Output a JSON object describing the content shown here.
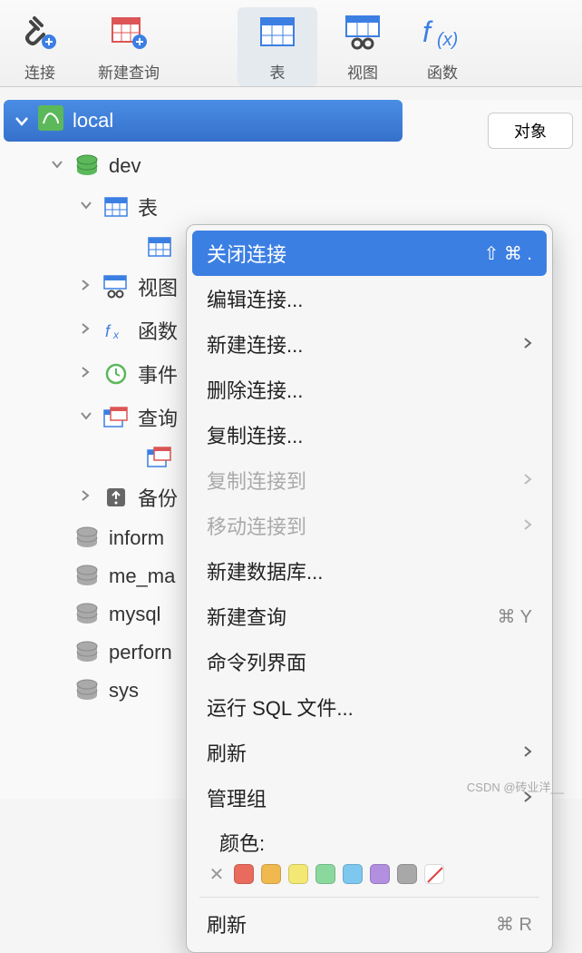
{
  "toolbar": [
    {
      "label": "连接",
      "icon": "plug"
    },
    {
      "label": "新建查询",
      "icon": "table-plus"
    },
    {
      "label": "表",
      "icon": "table"
    },
    {
      "label": "视图",
      "icon": "view"
    },
    {
      "label": "函数",
      "icon": "fx"
    }
  ],
  "object_tab": "对象",
  "connection": "local",
  "tree": [
    {
      "label": "dev",
      "icon": "db-green",
      "indent": 1,
      "open": true
    },
    {
      "label": "表",
      "icon": "table-blue",
      "indent": 2,
      "open": true
    },
    {
      "label": "",
      "icon": "table-blue",
      "indent": 3,
      "open": null
    },
    {
      "label": "视图",
      "icon": "view",
      "indent": 2,
      "open": false
    },
    {
      "label": "函数",
      "icon": "fx-blue",
      "indent": 2,
      "open": false
    },
    {
      "label": "事件",
      "icon": "clock",
      "indent": 2,
      "open": false
    },
    {
      "label": "查询",
      "icon": "query",
      "indent": 2,
      "open": true
    },
    {
      "label": "",
      "icon": "query",
      "indent": 3,
      "open": null
    },
    {
      "label": "备份",
      "icon": "backup",
      "indent": 2,
      "open": false
    },
    {
      "label": "inform",
      "icon": "db-gray",
      "indent": 1,
      "open": null
    },
    {
      "label": "me_ma",
      "icon": "db-gray",
      "indent": 1,
      "open": null
    },
    {
      "label": "mysql",
      "icon": "db-gray",
      "indent": 1,
      "open": null
    },
    {
      "label": "perforn",
      "icon": "db-gray",
      "indent": 1,
      "open": null
    },
    {
      "label": "sys",
      "icon": "db-gray",
      "indent": 1,
      "open": null
    }
  ],
  "context_menu": [
    {
      "label": "关闭连接",
      "shortcut": "⇧ ⌘ .",
      "selected": true
    },
    {
      "label": "编辑连接..."
    },
    {
      "label": "新建连接...",
      "submenu": true
    },
    {
      "label": "删除连接..."
    },
    {
      "label": "复制连接..."
    },
    {
      "label": "复制连接到",
      "disabled": true,
      "submenu": true
    },
    {
      "label": "移动连接到",
      "disabled": true,
      "submenu": true
    },
    {
      "label": "新建数据库..."
    },
    {
      "label": "新建查询",
      "shortcut": "⌘ Y"
    },
    {
      "label": "命令列界面"
    },
    {
      "label": "运行 SQL 文件..."
    },
    {
      "label": "刷新",
      "submenu": true
    },
    {
      "label": "管理组",
      "submenu": true
    }
  ],
  "color_section": {
    "label": "颜色:",
    "swatches": [
      "#e96b5d",
      "#f0b94f",
      "#f3e873",
      "#8ad89d",
      "#7ec7ee",
      "#b38fe0",
      "#a8a8a8"
    ],
    "none_slash": "#d44"
  },
  "context_footer": {
    "label": "刷新",
    "shortcut": "⌘ R"
  },
  "watermark": "@砖业洋__",
  "footer_text": "CSDN @砖业洋__"
}
